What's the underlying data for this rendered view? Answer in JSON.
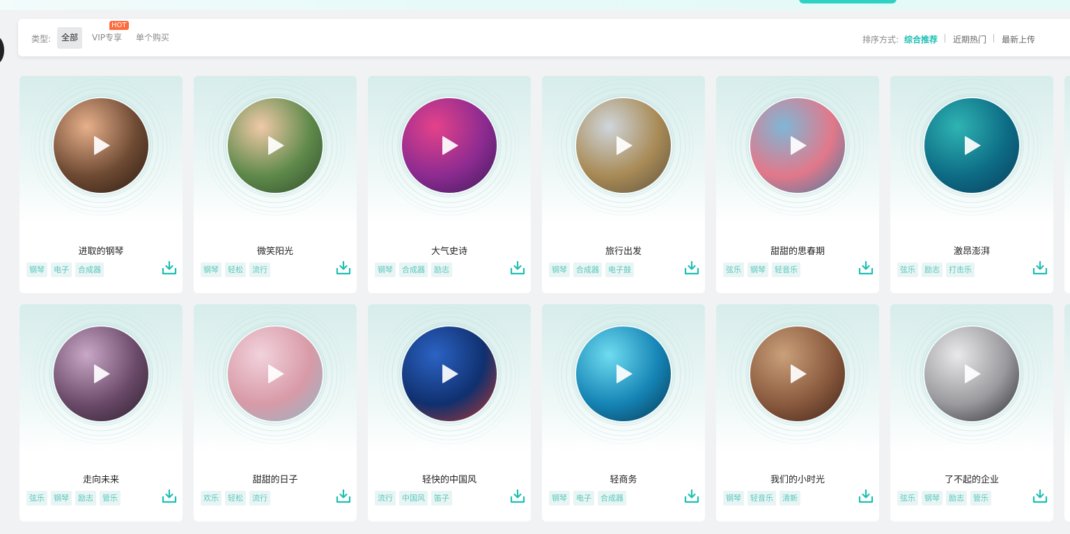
{
  "filter": {
    "type_label": "类型:",
    "types": [
      {
        "label": "全部"
      },
      {
        "label": "VIP专享",
        "badge": "HOT"
      },
      {
        "label": "单个购买"
      }
    ],
    "sort_label": "排序方式:",
    "sorts": [
      {
        "label": "综合推荐"
      },
      {
        "label": "近期热门"
      },
      {
        "label": "最新上传"
      }
    ]
  },
  "colors": {
    "accent": "#1ebfb3",
    "hot": "#ff6b3d",
    "tag_bg": "#e8f5f4"
  },
  "cards": [
    {
      "title": "进取的钢琴",
      "tags": [
        "钢琴",
        "电子",
        "合成器"
      ],
      "image": "sunset-climbers",
      "grad": [
        "#e7b08b",
        "#6e4a33",
        "#2b1a12"
      ]
    },
    {
      "title": "微笑阳光",
      "tags": [
        "钢琴",
        "轻松",
        "流行"
      ],
      "image": "smiling-child-in-flowers",
      "grad": [
        "#f0c9a8",
        "#5f8a4b",
        "#2f4a2c"
      ]
    },
    {
      "title": "大气史诗",
      "tags": [
        "钢琴",
        "合成器",
        "励志"
      ],
      "image": "purple-pink-smoke",
      "grad": [
        "#e5428a",
        "#8c2b91",
        "#3a1a55"
      ]
    },
    {
      "title": "旅行出发",
      "tags": [
        "钢琴",
        "合成器",
        "电子鼓"
      ],
      "image": "mountain-road-camper",
      "grad": [
        "#cfd6dc",
        "#a88a55",
        "#5c5142"
      ]
    },
    {
      "title": "甜甜的思春期",
      "tags": [
        "弦乐",
        "钢琴",
        "轻音乐"
      ],
      "image": "starfish-on-blue-wood",
      "grad": [
        "#7fb7d6",
        "#e2788a",
        "#3c7ca3"
      ]
    },
    {
      "title": "激昂澎湃",
      "tags": [
        "弦乐",
        "励志",
        "打击乐"
      ],
      "image": "surfing-wave",
      "grad": [
        "#2fb4b3",
        "#0d6c85",
        "#0b3b5a"
      ]
    },
    {
      "title": "走向未来",
      "tags": [
        "弦乐",
        "钢琴",
        "励志",
        "管乐"
      ],
      "image": "success-silhouette",
      "grad": [
        "#c9a8c7",
        "#6b4a6a",
        "#2a1f2b"
      ]
    },
    {
      "title": "甜甜的日子",
      "tags": [
        "欢乐",
        "轻松",
        "流行"
      ],
      "image": "pink-cake-pops",
      "grad": [
        "#f1d2dc",
        "#d89aa7",
        "#8fb8c9"
      ]
    },
    {
      "title": "轻快的中国风",
      "tags": [
        "流行",
        "中国风",
        "笛子"
      ],
      "image": "chinese-lantern-night",
      "grad": [
        "#2c63c4",
        "#10306f",
        "#c0382b"
      ]
    },
    {
      "title": "轻商务",
      "tags": [
        "钢琴",
        "电子",
        "合成器"
      ],
      "image": "digital-network-hologram",
      "grad": [
        "#6fdcf0",
        "#1584b5",
        "#07354f"
      ]
    },
    {
      "title": "我们的小时光",
      "tags": [
        "钢琴",
        "轻音乐",
        "清新"
      ],
      "image": "hanging-doll-bokeh",
      "grad": [
        "#caa07a",
        "#8a5a3e",
        "#3d2218"
      ]
    },
    {
      "title": "了不起的企业",
      "tags": [
        "弦乐",
        "钢琴",
        "励志",
        "管乐"
      ],
      "image": "business-handshake",
      "grad": [
        "#e9e9ea",
        "#9a9a9e",
        "#2a2a2e"
      ]
    }
  ]
}
